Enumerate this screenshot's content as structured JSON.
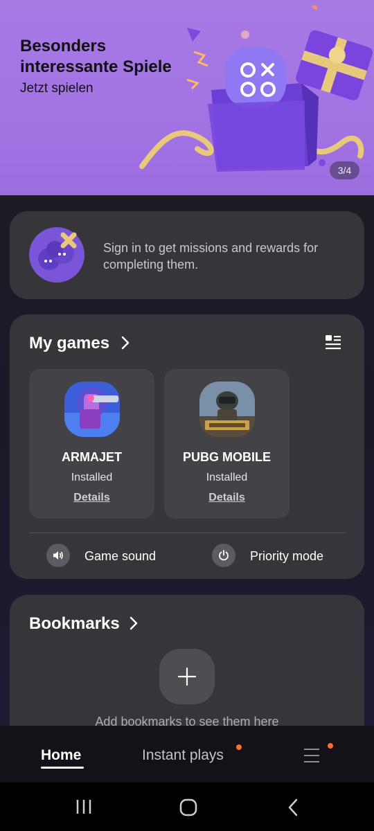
{
  "banner": {
    "title": "Besonders interessante Spiele",
    "subtitle": "Jetzt spielen",
    "page_indicator": "3/4"
  },
  "signin": {
    "text": "Sign in to get missions and rewards for completing them."
  },
  "my_games": {
    "title": "My games",
    "games": [
      {
        "name": "ARMAJET",
        "status": "Installed",
        "details": "Details"
      },
      {
        "name": "PUBG MOBILE",
        "status": "Installed",
        "details": "Details"
      }
    ],
    "game_sound_label": "Game sound",
    "priority_mode_label": "Priority mode"
  },
  "bookmarks": {
    "title": "Bookmarks",
    "empty_text": "Add bookmarks to see them here"
  },
  "nav": {
    "home": "Home",
    "instant_plays": "Instant plays",
    "active_tab": "Home"
  },
  "colors": {
    "banner_bg": "#a173e3",
    "card_bg": "#363539",
    "notification_dot": "#ff6d2d"
  },
  "icons": [
    "chevron-right-icon",
    "list-view-icon",
    "speaker-icon",
    "power-icon",
    "plus-icon",
    "menu-icon",
    "recents-icon",
    "home-icon",
    "back-icon"
  ]
}
